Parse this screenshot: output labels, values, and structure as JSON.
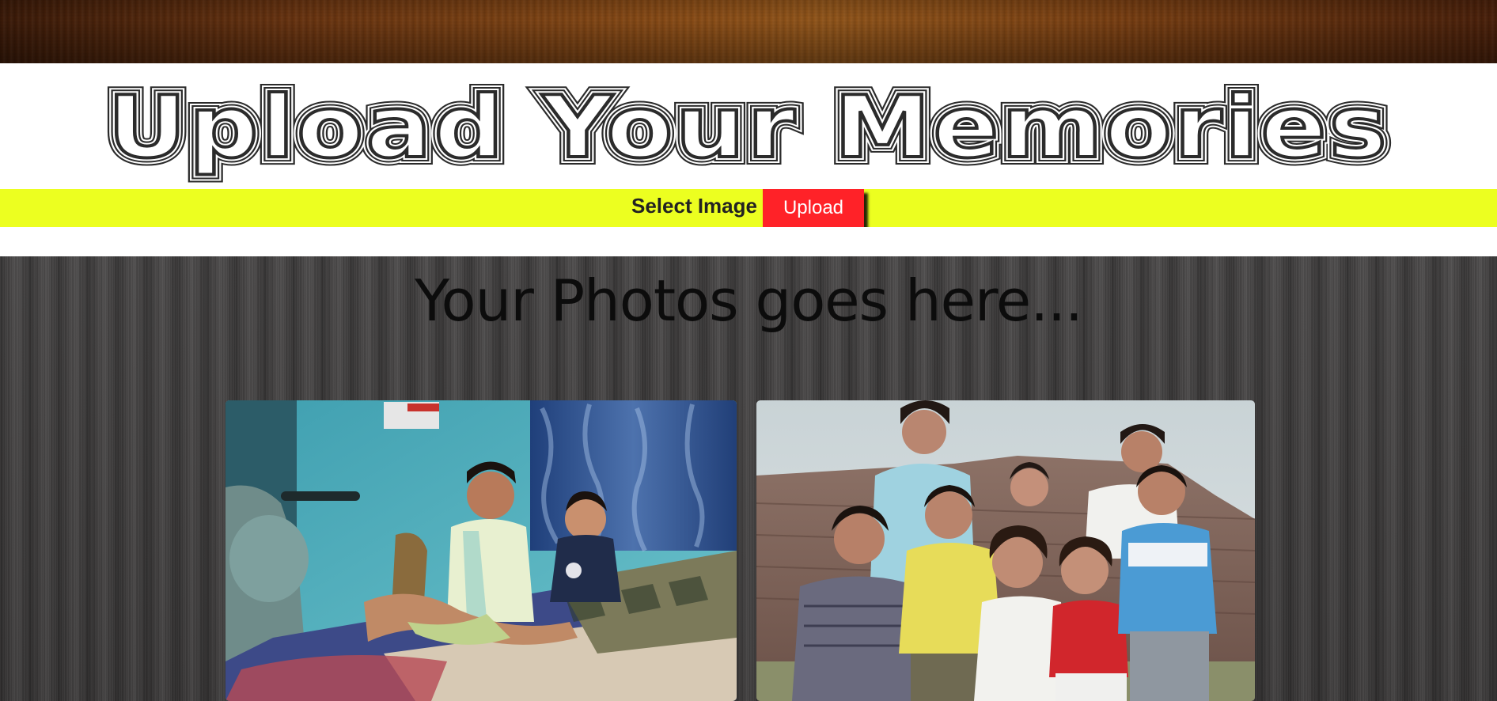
{
  "header": {
    "title": "Upload Your Memories"
  },
  "upload": {
    "select_label": "Select Image",
    "upload_label": "Upload"
  },
  "gallery": {
    "heading": "Your Photos goes here...",
    "photos": [
      {
        "name": "children-on-bed-photo"
      },
      {
        "name": "group-of-children-photo"
      }
    ],
    "colors": {
      "upload_bar": "#ecff20",
      "upload_button": "#ff2228"
    }
  }
}
